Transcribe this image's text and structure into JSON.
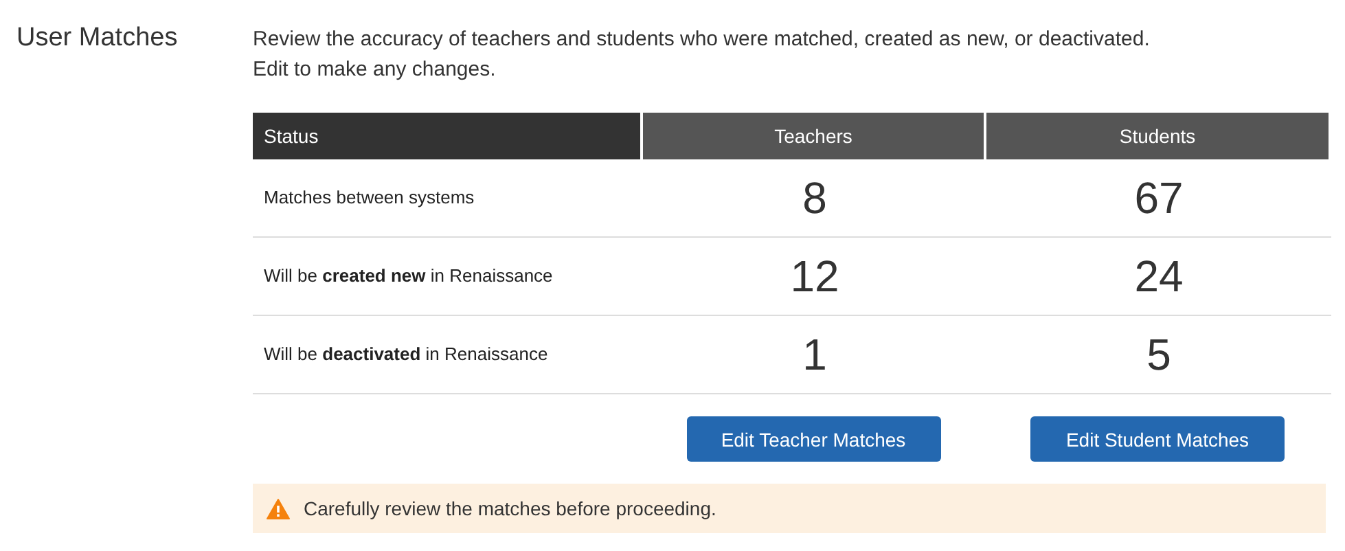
{
  "section_title": "User Matches",
  "description": [
    "Review the accuracy of teachers and students who were matched, created as new, or deactivated.",
    "Edit to make any changes."
  ],
  "table": {
    "columns": [
      "Status",
      "Teachers",
      "Students"
    ],
    "rows": [
      {
        "status": "Matches between systems",
        "teachers": "8",
        "students": "67"
      },
      {
        "status": "Will be **created new** in Renaissance",
        "teachers": "12",
        "students": "24"
      },
      {
        "status": "Will be **deactivated** in Renaissance",
        "teachers": "1",
        "students": "5"
      }
    ]
  },
  "buttons": [
    "Edit Teacher Matches",
    "Edit Student Matches"
  ],
  "alert": {
    "kind": "warning",
    "text": "Carefully review the matches before proceeding."
  }
}
